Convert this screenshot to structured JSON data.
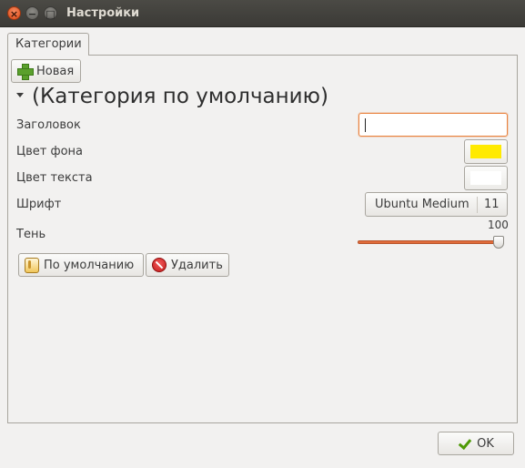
{
  "window": {
    "title": "Настройки",
    "close_glyph": "×",
    "minimize_glyph": "−",
    "maximize_glyph": "□"
  },
  "tabs": [
    {
      "label": "Категории",
      "active": true
    }
  ],
  "toolbar": {
    "new_label": "Новая",
    "new_icon": "plus-icon"
  },
  "category": {
    "heading": "(Категория по умолчанию)",
    "expanded": true,
    "fields": {
      "title": {
        "label": "Заголовок",
        "value": ""
      },
      "background_color": {
        "label": "Цвет фона",
        "value": "#ffea00"
      },
      "text_color": {
        "label": "Цвет текста",
        "value": "#ffffff"
      },
      "font": {
        "label": "Шрифт",
        "family": "Ubuntu Medium",
        "size": "11"
      },
      "shadow": {
        "label": "Тень",
        "value": "100",
        "fraction": 1.0
      }
    },
    "actions": {
      "default_label": "По умолчанию",
      "default_icon": "hand-icon",
      "delete_label": "Удалить",
      "delete_icon": "stop-icon"
    }
  },
  "footer": {
    "ok_label": "OK",
    "ok_icon": "check-icon"
  },
  "colors": {
    "titlebar": "#3c3b37",
    "accent": "#e06b3a",
    "focus_border": "#e9833f"
  }
}
